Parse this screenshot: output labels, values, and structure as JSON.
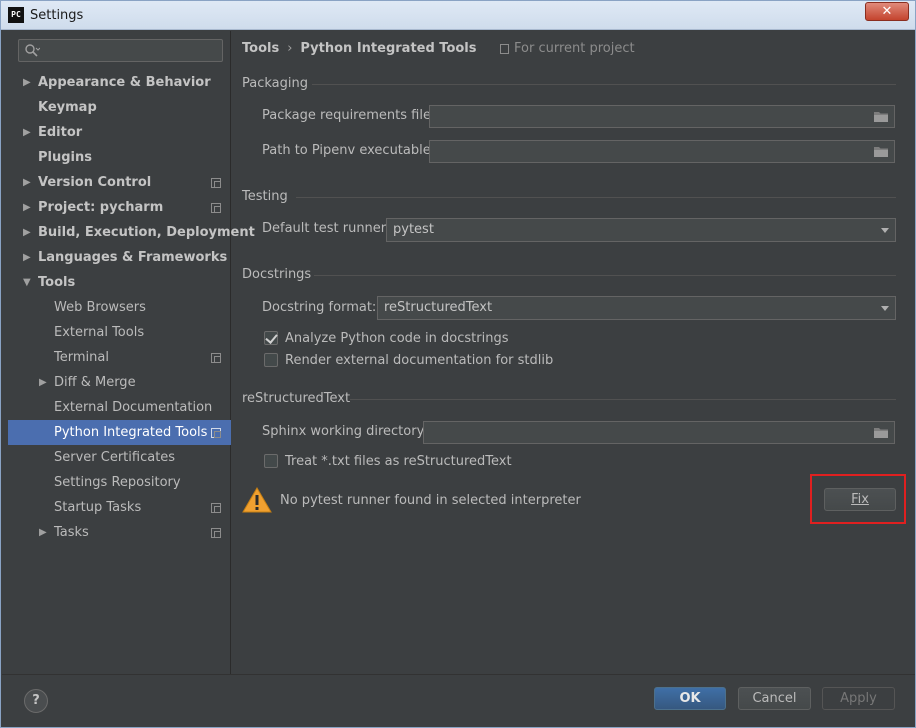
{
  "window": {
    "title": "Settings",
    "app_icon_text": "PC",
    "close_glyph": "✕"
  },
  "sidebar": {
    "search_placeholder": "",
    "items": [
      {
        "label": "Appearance & Behavior",
        "expandable": true,
        "expanded": false,
        "level": 0,
        "bold": true,
        "project_scope": false
      },
      {
        "label": "Keymap",
        "expandable": false,
        "level": 0,
        "bold": true,
        "project_scope": false
      },
      {
        "label": "Editor",
        "expandable": true,
        "expanded": false,
        "level": 0,
        "bold": true,
        "project_scope": false
      },
      {
        "label": "Plugins",
        "expandable": false,
        "level": 0,
        "bold": true,
        "project_scope": false
      },
      {
        "label": "Version Control",
        "expandable": true,
        "expanded": false,
        "level": 0,
        "bold": true,
        "project_scope": true
      },
      {
        "label": "Project: pycharm",
        "expandable": true,
        "expanded": false,
        "level": 0,
        "bold": true,
        "project_scope": true
      },
      {
        "label": "Build, Execution, Deployment",
        "expandable": true,
        "expanded": false,
        "level": 0,
        "bold": true,
        "project_scope": false
      },
      {
        "label": "Languages & Frameworks",
        "expandable": true,
        "expanded": false,
        "level": 0,
        "bold": true,
        "project_scope": false
      },
      {
        "label": "Tools",
        "expandable": true,
        "expanded": true,
        "level": 0,
        "bold": true,
        "project_scope": false
      },
      {
        "label": "Web Browsers",
        "expandable": false,
        "level": 1,
        "bold": false,
        "project_scope": false
      },
      {
        "label": "External Tools",
        "expandable": false,
        "level": 1,
        "bold": false,
        "project_scope": false
      },
      {
        "label": "Terminal",
        "expandable": false,
        "level": 1,
        "bold": false,
        "project_scope": true
      },
      {
        "label": "Diff & Merge",
        "expandable": true,
        "expanded": false,
        "level": 1,
        "bold": false,
        "project_scope": false
      },
      {
        "label": "External Documentation",
        "expandable": false,
        "level": 1,
        "bold": false,
        "project_scope": false
      },
      {
        "label": "Python Integrated Tools",
        "expandable": false,
        "level": 1,
        "bold": false,
        "project_scope": true,
        "selected": true
      },
      {
        "label": "Server Certificates",
        "expandable": false,
        "level": 1,
        "bold": false,
        "project_scope": false
      },
      {
        "label": "Settings Repository",
        "expandable": false,
        "level": 1,
        "bold": false,
        "project_scope": false
      },
      {
        "label": "Startup Tasks",
        "expandable": false,
        "level": 1,
        "bold": false,
        "project_scope": true
      },
      {
        "label": "Tasks",
        "expandable": true,
        "expanded": false,
        "level": 1,
        "bold": false,
        "project_scope": true
      }
    ]
  },
  "breadcrumb": {
    "parent": "Tools",
    "separator": "›",
    "current": "Python Integrated Tools"
  },
  "scope_note": "For current project",
  "packaging": {
    "title": "Packaging",
    "requirements_label": "Package requirements file:",
    "requirements_value": "",
    "pipenv_label": "Path to Pipenv executable:",
    "pipenv_value": ""
  },
  "testing": {
    "title": "Testing",
    "runner_label": "Default test runner:",
    "runner_value": "pytest"
  },
  "docstrings": {
    "title": "Docstrings",
    "format_label": "Docstring format:",
    "format_value": "reStructuredText",
    "analyze_label": "Analyze Python code in docstrings",
    "analyze_checked": true,
    "render_label": "Render external documentation for stdlib",
    "render_checked": false
  },
  "rst": {
    "title": "reStructuredText",
    "sphinx_label": "Sphinx working directory:",
    "sphinx_value": "",
    "txt_label": "Treat *.txt files as reStructuredText",
    "txt_checked": false
  },
  "warning": {
    "message": "No pytest runner found in selected interpreter",
    "fix_label": "Fix"
  },
  "footer": {
    "help_label": "?",
    "ok_label": "OK",
    "cancel_label": "Cancel",
    "apply_label": "Apply"
  },
  "colors": {
    "accent": "#4b6eaf",
    "background": "#3c3f41",
    "highlight_box": "#e02020",
    "warning": "#f0a030"
  }
}
